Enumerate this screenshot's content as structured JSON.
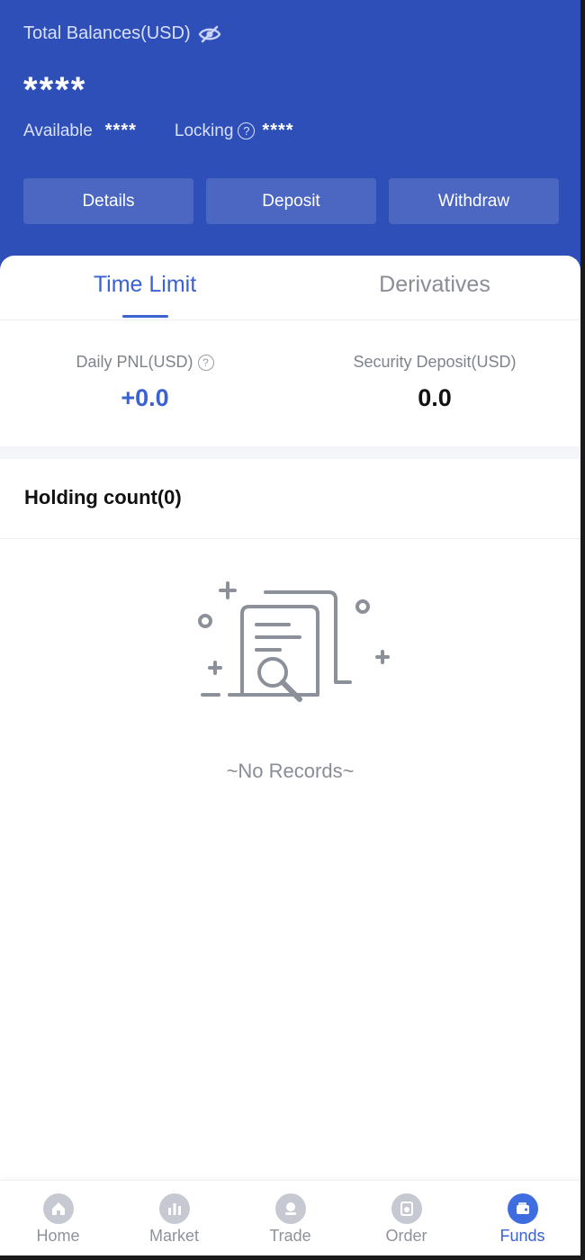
{
  "header": {
    "total_label": "Total Balances(USD)",
    "total_value": "****",
    "available_label": "Available",
    "available_value": "****",
    "locking_label": "Locking",
    "locking_value": "****",
    "actions": [
      {
        "label": "Details"
      },
      {
        "label": "Deposit"
      },
      {
        "label": "Withdraw"
      }
    ]
  },
  "tabs": [
    {
      "label": "Time Limit",
      "active": true
    },
    {
      "label": "Derivatives",
      "active": false
    }
  ],
  "stats": {
    "daily_pnl_label": "Daily PNL(USD)",
    "daily_pnl_value": "+0.0",
    "security_deposit_label": "Security Deposit(USD)",
    "security_deposit_value": "0.0"
  },
  "holding": {
    "title": "Holding count(0)"
  },
  "empty": {
    "text": "~No Records~"
  },
  "nav": [
    {
      "label": "Home",
      "icon": "home-icon",
      "active": false
    },
    {
      "label": "Market",
      "icon": "market-icon",
      "active": false
    },
    {
      "label": "Trade",
      "icon": "trade-icon",
      "active": false
    },
    {
      "label": "Order",
      "icon": "order-icon",
      "active": false
    },
    {
      "label": "Funds",
      "icon": "funds-icon",
      "active": true
    }
  ],
  "colors": {
    "brand": "#2f4fb8",
    "accent": "#3a62d0",
    "muted": "#8a8d96"
  }
}
